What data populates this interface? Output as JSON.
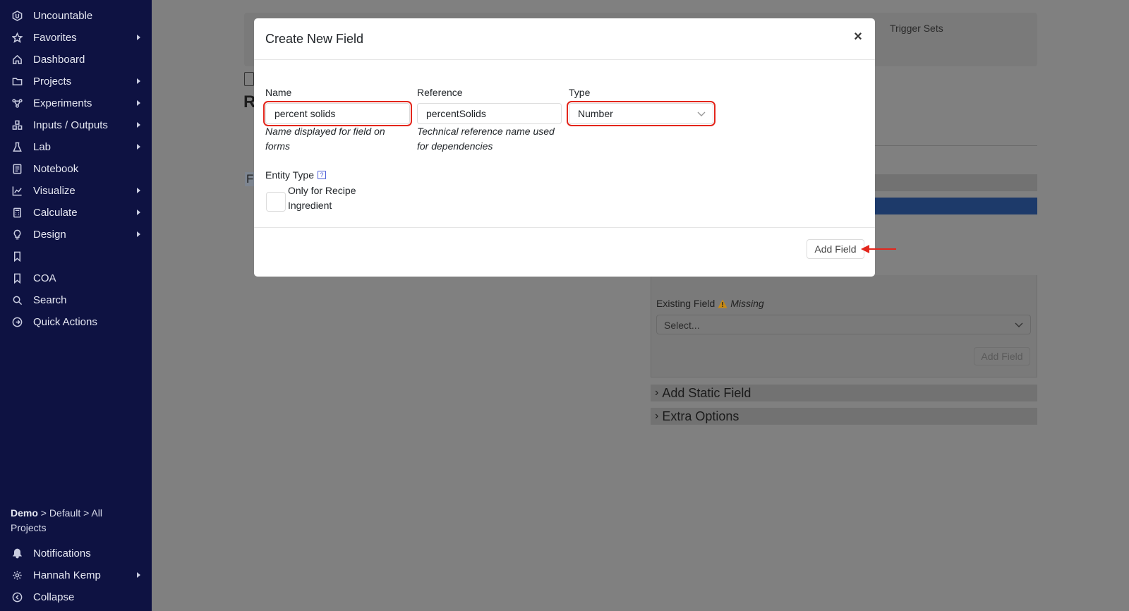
{
  "sidebar": {
    "items": [
      {
        "label": "Uncountable",
        "icon": "logo-icon",
        "caret": false
      },
      {
        "label": "Favorites",
        "icon": "star-icon",
        "caret": true
      },
      {
        "label": "Dashboard",
        "icon": "home-icon",
        "caret": false
      },
      {
        "label": "Projects",
        "icon": "folder-icon",
        "caret": true
      },
      {
        "label": "Experiments",
        "icon": "experiments-icon",
        "caret": true
      },
      {
        "label": "Inputs / Outputs",
        "icon": "inputs-outputs-icon",
        "caret": true
      },
      {
        "label": "Lab",
        "icon": "flask-icon",
        "caret": true
      },
      {
        "label": "Notebook",
        "icon": "notebook-icon",
        "caret": false
      },
      {
        "label": "Visualize",
        "icon": "chart-icon",
        "caret": true
      },
      {
        "label": "Calculate",
        "icon": "calculator-icon",
        "caret": true
      },
      {
        "label": "Design",
        "icon": "lightbulb-icon",
        "caret": true
      },
      {
        "label": "",
        "icon": "bookmark-icon",
        "caret": false
      },
      {
        "label": "COA",
        "icon": "bookmark-icon",
        "caret": false
      },
      {
        "label": "Search",
        "icon": "search-icon",
        "caret": false
      },
      {
        "label": "Quick Actions",
        "icon": "quick-actions-icon",
        "caret": false
      }
    ],
    "breadcrumb": {
      "root": "Demo",
      "rest": " > Default > All Projects"
    },
    "bottom_items": [
      {
        "label": "Notifications",
        "icon": "bell-icon",
        "caret": false
      },
      {
        "label": "Hannah Kemp",
        "icon": "gear-icon",
        "caret": true
      },
      {
        "label": "Collapse",
        "icon": "collapse-icon",
        "caret": false
      }
    ]
  },
  "background": {
    "trigger_sets": "Trigger Sets",
    "heading_letter": "R",
    "section_letter": "F",
    "existing_field_label": "Existing Field",
    "missing_label": "Missing",
    "select_placeholder": "Select...",
    "add_field_label": "Add Field",
    "add_static_field": "Add Static Field",
    "extra_options": "Extra Options"
  },
  "modal": {
    "title": "Create New Field",
    "name": {
      "label": "Name",
      "value": "percent solids",
      "helper": "Name displayed for field on forms"
    },
    "reference": {
      "label": "Reference",
      "value": "percentSolids",
      "helper": "Technical reference name used for dependencies"
    },
    "type": {
      "label": "Type",
      "value": "Number"
    },
    "entity_type_label": "Entity Type",
    "entity_help": "?",
    "checkbox_label": "Only for Recipe Ingredient",
    "add_button": "Add Field"
  },
  "colors": {
    "sidebar_bg": "#0e1242",
    "highlight": "#e3261c",
    "accent_blue": "#1d3a6a"
  }
}
